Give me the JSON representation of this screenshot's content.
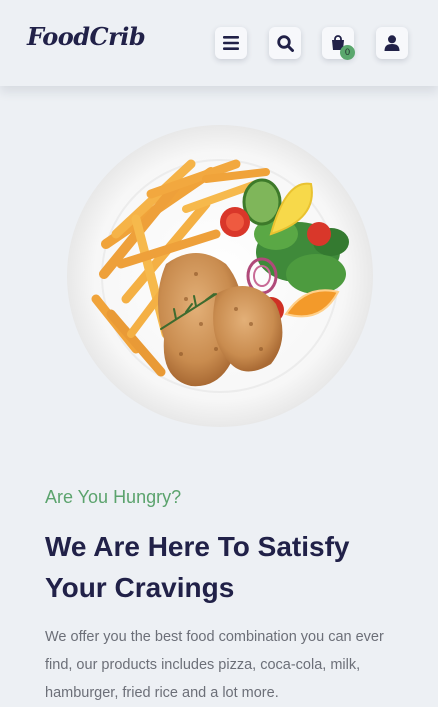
{
  "header": {
    "logo_text": "FoodCrib",
    "cart_count": "0",
    "icons": [
      "menu-icon",
      "search-icon",
      "shopping-bag-icon",
      "user-icon"
    ]
  },
  "hero": {
    "image_subject": "plate of roast chicken, fries, tomato and salad"
  },
  "intro": {
    "tagline": "Are You Hungry?",
    "heading": "We Are Here To Satisfy Your Cravings",
    "description": "We offer you the best food combination you can ever find, our products includes pizza, coca-cola, milk, hamburger, fried rice and a lot more."
  },
  "colors": {
    "background": "#edf0f4",
    "brand_dark": "#212148",
    "accent_green": "#5ba36d",
    "body_text": "#6c6f78"
  }
}
